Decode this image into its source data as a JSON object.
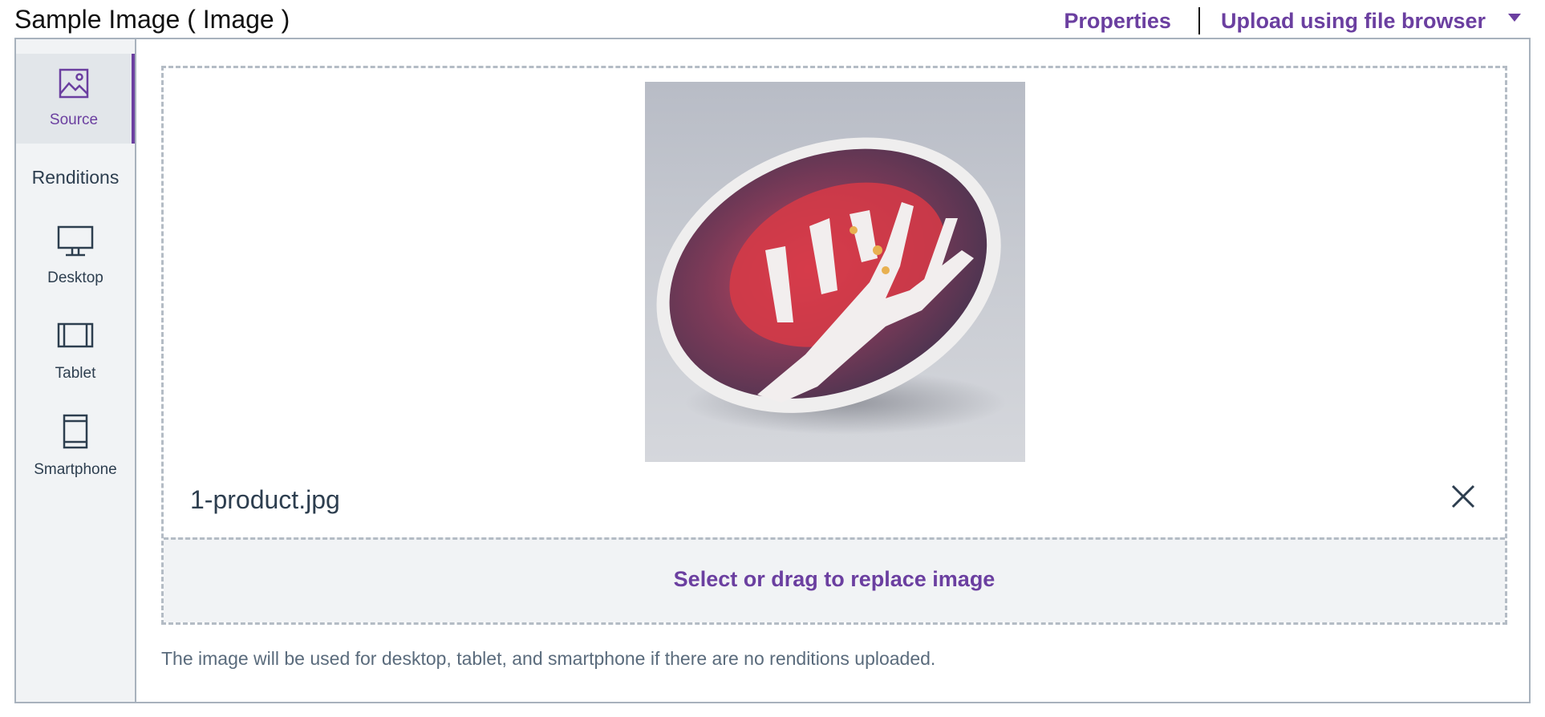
{
  "header": {
    "title": "Sample Image ( Image )",
    "properties_label": "Properties",
    "upload_label": "Upload using file browser"
  },
  "sidebar": {
    "source_label": "Source",
    "renditions_heading": "Renditions",
    "items": [
      {
        "label": "Desktop",
        "icon": "desktop-icon"
      },
      {
        "label": "Tablet",
        "icon": "tablet-icon"
      },
      {
        "label": "Smartphone",
        "icon": "smartphone-icon"
      }
    ]
  },
  "image": {
    "file_name": "1-product.jpg",
    "replace_label": "Select or drag to replace image"
  },
  "hint_text": "The image will be used for desktop, tablet, and smartphone if there are no renditions uploaded.",
  "colors": {
    "accent": "#6b3fa0",
    "text": "#2d3e4f",
    "border": "#a8b2bd",
    "sidebar_bg": "#f1f3f5"
  }
}
